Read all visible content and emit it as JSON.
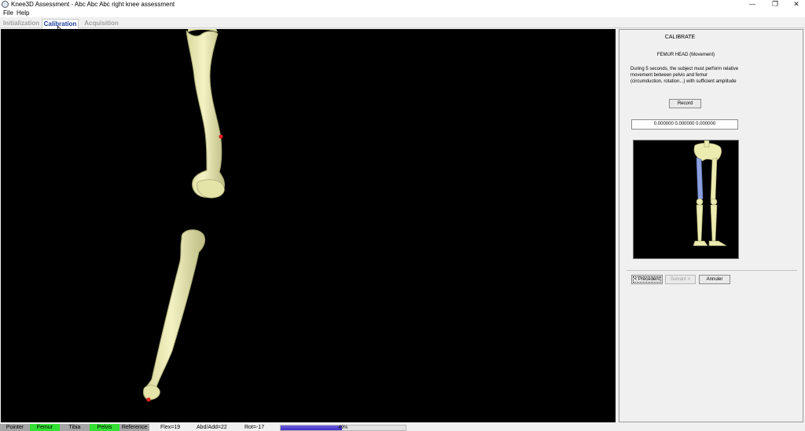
{
  "window": {
    "title": "Knee3D Assessment - Abc Abc Abc right knee assessment",
    "controls": {
      "minimize": "—",
      "restore": "❐",
      "close": "✕"
    }
  },
  "menu": {
    "file": "File",
    "help": "Help"
  },
  "tabs": [
    {
      "label": "Initialization",
      "state": "disabled"
    },
    {
      "label": "Calibration",
      "state": "active"
    },
    {
      "label": "Acquisition",
      "state": "disabled"
    }
  ],
  "panel": {
    "title": "CALIBRATE",
    "subtitle": "FEMUR HEAD (Movement)",
    "instructions": "During 5 seconds, the subject must perform relative movement between pelvis and femur (circumduction, rotation...) with sufficient amplitude",
    "record_button": "Record",
    "coordinates": "0.000000   0.000000   0.000000",
    "nav": {
      "previous": "< Précédent",
      "next": "Suivant >",
      "cancel": "Annuler"
    }
  },
  "status": {
    "markers": [
      {
        "label": "Pointer",
        "color": "#a6a6a6"
      },
      {
        "label": "Femur",
        "color": "#33e033"
      },
      {
        "label": "Tibia",
        "color": "#a6a6a6"
      },
      {
        "label": "Pelvis",
        "color": "#33e033"
      },
      {
        "label": "Reference",
        "color": "#a6a6a6"
      }
    ],
    "flex": "Flex=19",
    "abd_add": "Abd/Add=22",
    "rot": "Rot=-17",
    "progress_label": "49%",
    "progress_fraction": 0.49
  },
  "colors": {
    "bone": "#ecebb0",
    "bone_shadow": "#c8c78a",
    "marker": "#e02020",
    "highlight_bone": "#8a9ee0",
    "active_tab": "#1d3fa0"
  },
  "icons": {
    "app": "knee3d-app-icon",
    "cursor": "mouse-pointer-icon"
  }
}
